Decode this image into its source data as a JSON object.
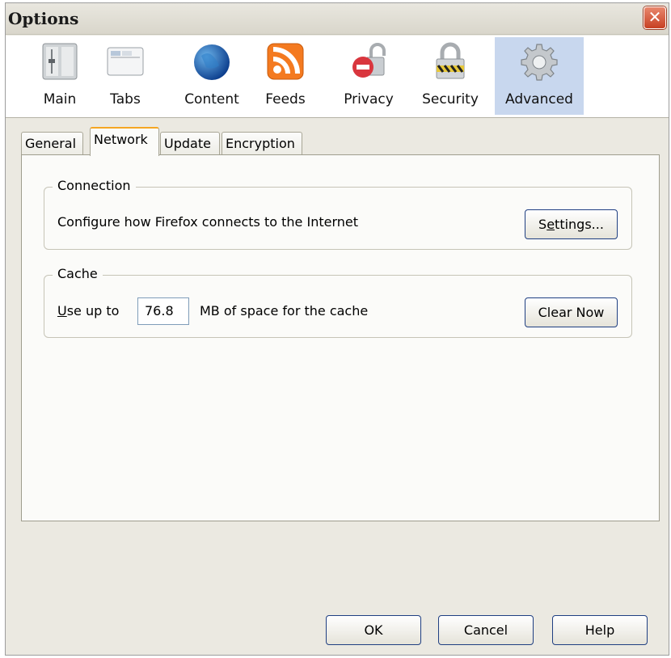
{
  "window": {
    "title": "Options",
    "close_glyph": "✕"
  },
  "panes": [
    {
      "label": "Main",
      "icon": "main-icon"
    },
    {
      "label": "Tabs",
      "icon": "tabs-icon"
    },
    {
      "label": "Content",
      "icon": "globe-icon"
    },
    {
      "label": "Feeds",
      "icon": "rss-feed-icon"
    },
    {
      "label": "Privacy",
      "icon": "privacy-lock-icon"
    },
    {
      "label": "Security",
      "icon": "security-padlock-icon"
    },
    {
      "label": "Advanced",
      "icon": "gear-icon",
      "selected": true
    }
  ],
  "tabs": [
    {
      "label": "General"
    },
    {
      "label": "Network",
      "selected": true
    },
    {
      "label": "Update"
    },
    {
      "label": "Encryption"
    }
  ],
  "connection": {
    "legend": "Connection",
    "description": "Configure how Firefox connects to the Internet",
    "settings_prefix": "S",
    "settings_accesskey": "e",
    "settings_suffix": "ttings..."
  },
  "cache": {
    "legend": "Cache",
    "use_up_accesskey": "U",
    "use_up_suffix": "se up to",
    "value": "76.8",
    "unit_text": "MB of space for the cache",
    "clear_label": "Clear Now"
  },
  "footer": {
    "ok_label": "OK",
    "cancel_label": "Cancel",
    "help_label": "Help"
  },
  "colors": {
    "selected_pane": "#c8d7ee",
    "tab_accent": "#f5a623",
    "close_button": "#c74023"
  }
}
